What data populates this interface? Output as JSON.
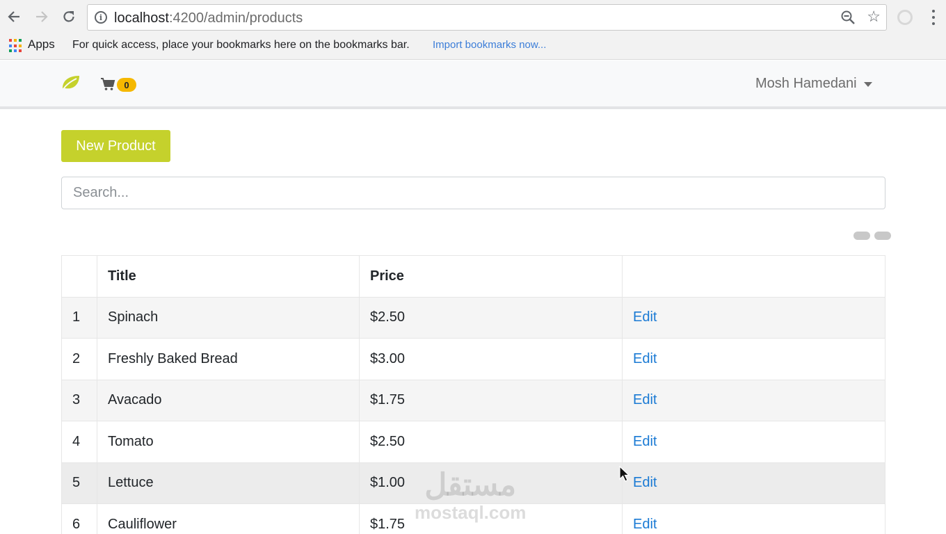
{
  "browser": {
    "url_host": "localhost",
    "url_path": ":4200/admin/products",
    "apps_label": "Apps",
    "bookmarks_hint": "For quick access, place your bookmarks here on the bookmarks bar.",
    "import_link": "Import bookmarks now..."
  },
  "navbar": {
    "cart_count": "0",
    "user_name": "Mosh Hamedani"
  },
  "main": {
    "new_product_label": "New Product",
    "search_placeholder": "Search..."
  },
  "table": {
    "headers": [
      "",
      "Title",
      "Price",
      ""
    ],
    "rows": [
      {
        "num": "1",
        "title": "Spinach",
        "price": "$2.50",
        "action": "Edit"
      },
      {
        "num": "2",
        "title": "Freshly Baked Bread",
        "price": "$3.00",
        "action": "Edit"
      },
      {
        "num": "3",
        "title": "Avacado",
        "price": "$1.75",
        "action": "Edit"
      },
      {
        "num": "4",
        "title": "Tomato",
        "price": "$2.50",
        "action": "Edit"
      },
      {
        "num": "5",
        "title": "Lettuce",
        "price": "$1.00",
        "action": "Edit"
      },
      {
        "num": "6",
        "title": "Cauliflower",
        "price": "$1.75",
        "action": "Edit"
      }
    ]
  },
  "watermark": {
    "arabic": "مستقل",
    "latin": "mostaql.com"
  },
  "colors": {
    "accent": "#c5d12c",
    "badge": "#f5b800",
    "link": "#1a7ad4"
  }
}
